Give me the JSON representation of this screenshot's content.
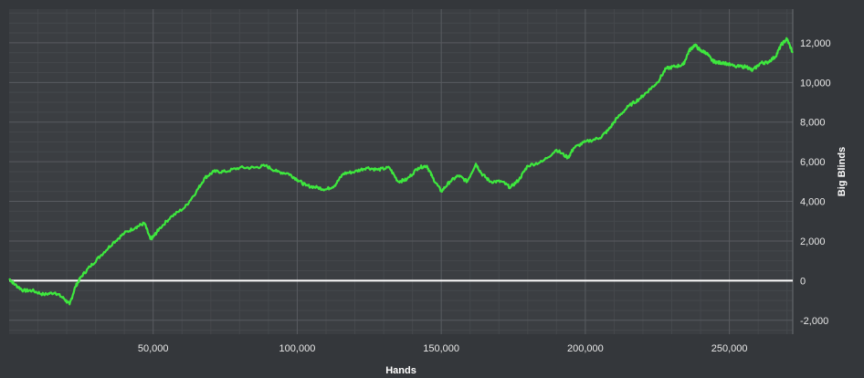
{
  "chart_data": {
    "type": "line",
    "xlabel": "Hands",
    "ylabel": "Big Blinds",
    "xlim": [
      0,
      272000
    ],
    "ylim": [
      -2700,
      13700
    ],
    "x_ticks": [
      50000,
      100000,
      150000,
      200000,
      250000
    ],
    "x_tick_labels": [
      "50,000",
      "100,000",
      "150,000",
      "200,000",
      "250,000"
    ],
    "y_ticks": [
      -2000,
      0,
      2000,
      4000,
      6000,
      8000,
      10000,
      12000
    ],
    "y_tick_labels": [
      "-2,000",
      "0",
      "2,000",
      "4,000",
      "6,000",
      "8,000",
      "10,000",
      "12,000"
    ],
    "grid": true,
    "legend": "none",
    "zero_line": 0,
    "series": [
      {
        "color": "#3ee83e",
        "x": [
          0,
          2000,
          5000,
          8000,
          12000,
          16000,
          19000,
          21000,
          23000,
          25000,
          28000,
          32000,
          36000,
          40000,
          44000,
          47000,
          49000,
          50000,
          52000,
          56000,
          61000,
          65000,
          68000,
          71000,
          75000,
          80000,
          85000,
          89000,
          93000,
          97000,
          100000,
          103000,
          107000,
          110000,
          113000,
          116000,
          120000,
          124000,
          128000,
          132000,
          135000,
          138000,
          142000,
          145000,
          147000,
          150000,
          153000,
          156000,
          159000,
          162000,
          164000,
          167000,
          171000,
          174000,
          177000,
          180000,
          185000,
          190000,
          194000,
          196000,
          200000,
          205000,
          208000,
          211000,
          215000,
          219000,
          222000,
          225000,
          228000,
          231000,
          234000,
          236000,
          238000,
          240000,
          242000,
          244000,
          246000,
          248000,
          252000,
          256000,
          258000,
          261000,
          263000,
          266000,
          268000,
          270000,
          272000
        ],
        "y": [
          100,
          -200,
          -500,
          -500,
          -700,
          -600,
          -900,
          -1200,
          -300,
          200,
          700,
          1300,
          1900,
          2400,
          2700,
          2900,
          2100,
          2200,
          2600,
          3200,
          3700,
          4500,
          5200,
          5500,
          5500,
          5700,
          5700,
          5800,
          5500,
          5400,
          5100,
          4800,
          4700,
          4600,
          4800,
          5400,
          5500,
          5700,
          5600,
          5700,
          5000,
          5100,
          5700,
          5800,
          5200,
          4500,
          5000,
          5300,
          5000,
          5900,
          5400,
          5000,
          5000,
          4700,
          5100,
          5800,
          6000,
          6600,
          6200,
          6700,
          7000,
          7200,
          7600,
          8200,
          8800,
          9200,
          9600,
          10000,
          10700,
          10800,
          10900,
          11600,
          11900,
          11600,
          11500,
          11100,
          11000,
          11000,
          10800,
          10800,
          10600,
          11000,
          11000,
          11300,
          11900,
          12200,
          11500
        ]
      }
    ]
  }
}
